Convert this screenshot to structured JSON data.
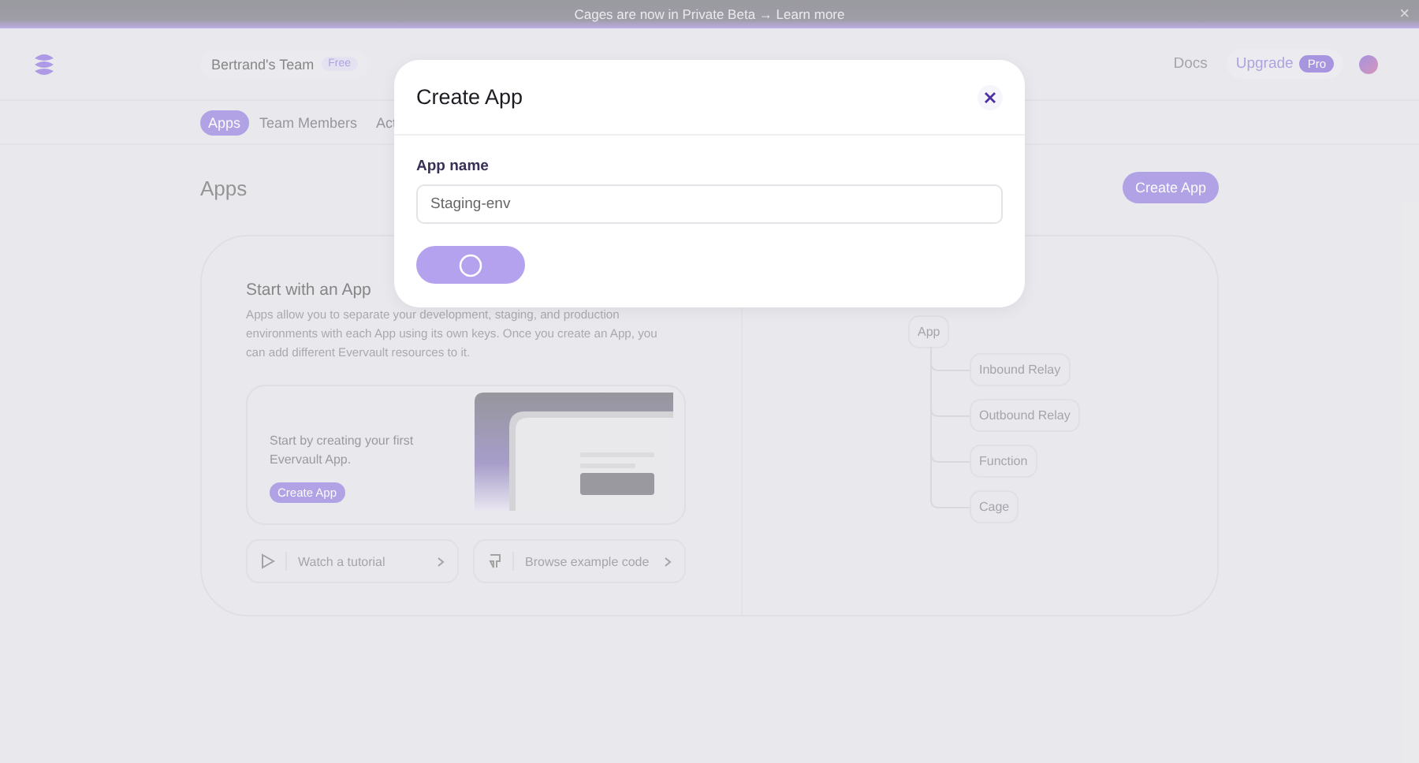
{
  "banner": {
    "text": "Cages are now in Private Beta → Learn more",
    "close": "×"
  },
  "header": {
    "team": "Bertrand's Team",
    "team_badge": "Free",
    "docs": "Docs",
    "upgrade": "Upgrade",
    "upgrade_badge": "Pro"
  },
  "tabs": [
    {
      "label": "Apps",
      "selected": true
    },
    {
      "label": "Team Members",
      "selected": false
    },
    {
      "label": "Act",
      "selected": false
    }
  ],
  "page": {
    "title": "Apps",
    "create_button": "Create App"
  },
  "intro": {
    "title": "Start with an App",
    "text": "Apps allow you to separate your development, staging, and production environments with each App using its own keys. Once you create an App, you can add different Evervault resources to it.",
    "cta_text": "Start by creating your first Evervault App.",
    "cta_button": "Create App"
  },
  "links": [
    {
      "kind": "video",
      "label": "Watch a tutorial"
    },
    {
      "kind": "code",
      "label": "Browse example code"
    }
  ],
  "tree": {
    "label": "App",
    "children": [
      {
        "label": "Inbound Relay"
      },
      {
        "label": "Outbound Relay"
      },
      {
        "label": "Function"
      },
      {
        "label": "Cage"
      }
    ]
  },
  "modal": {
    "title": "Create App",
    "field_label": "App name",
    "field_value": "Staging-env",
    "submit_loading": true
  }
}
